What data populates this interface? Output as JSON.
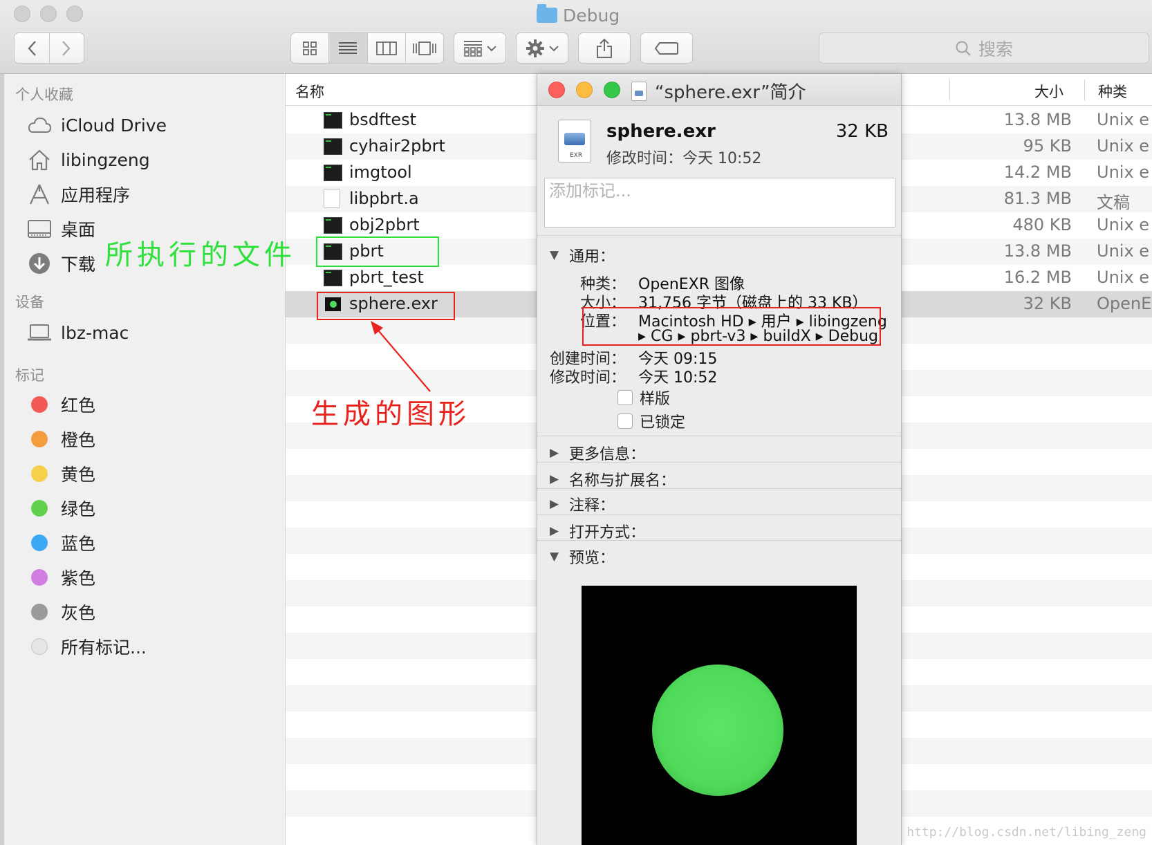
{
  "window": {
    "title": "Debug",
    "traffic_lights": [
      "close",
      "minimize",
      "zoom"
    ]
  },
  "toolbar": {
    "search_placeholder": "搜索",
    "icons": [
      "chevron-left-icon",
      "chevron-right-icon",
      "icon-view-icon",
      "list-view-icon",
      "column-view-icon",
      "cover-flow-icon",
      "arrange-icon",
      "gear-icon",
      "share-icon",
      "tag-icon",
      "search-icon"
    ],
    "active_view": "list"
  },
  "sidebar": {
    "favorites_header": "个人收藏",
    "favorites": [
      {
        "label": "iCloud Drive",
        "icon": "cloud-icon"
      },
      {
        "label": "libingzeng",
        "icon": "home-icon"
      },
      {
        "label": "应用程序",
        "icon": "applications-icon"
      },
      {
        "label": "桌面",
        "icon": "desktop-icon"
      },
      {
        "label": "下载",
        "icon": "downloads-icon"
      }
    ],
    "devices_header": "设备",
    "devices": [
      {
        "label": "lbz-mac",
        "icon": "laptop-icon"
      }
    ],
    "tags_header": "标记",
    "tags": [
      {
        "label": "红色",
        "color": "#f25a55"
      },
      {
        "label": "橙色",
        "color": "#f49d3f"
      },
      {
        "label": "黄色",
        "color": "#f6d04b"
      },
      {
        "label": "绿色",
        "color": "#62cf4d"
      },
      {
        "label": "蓝色",
        "color": "#3da8f3"
      },
      {
        "label": "紫色",
        "color": "#d07fe0"
      },
      {
        "label": "灰色",
        "color": "#9a9a9a"
      },
      {
        "label": "所有标记...",
        "color": "#dcdcdc"
      }
    ]
  },
  "list": {
    "columns": {
      "name": "名称",
      "size": "大小",
      "kind": "种类"
    },
    "rows": [
      {
        "name": "bsdftest",
        "size": "13.8 MB",
        "kind": "Unix e",
        "icon": "exec"
      },
      {
        "name": "cyhair2pbrt",
        "size": "95 KB",
        "kind": "Unix e",
        "icon": "exec"
      },
      {
        "name": "imgtool",
        "size": "14.2 MB",
        "kind": "Unix e",
        "icon": "exec"
      },
      {
        "name": "libpbrt.a",
        "size": "81.3 MB",
        "kind": "文稿",
        "icon": "doc"
      },
      {
        "name": "obj2pbrt",
        "size": "480 KB",
        "kind": "Unix e",
        "icon": "exec"
      },
      {
        "name": "pbrt",
        "size": "13.8 MB",
        "kind": "Unix e",
        "icon": "exec"
      },
      {
        "name": "pbrt_test",
        "size": "16.2 MB",
        "kind": "Unix e",
        "icon": "exec"
      },
      {
        "name": "sphere.exr",
        "size": "32 KB",
        "kind": "OpenE",
        "icon": "exr",
        "selected": true
      }
    ]
  },
  "info": {
    "title": "“sphere.exr”简介",
    "icon_label": "EXR",
    "name": "sphere.exr",
    "size": "32 KB",
    "modified_line": "修改时间：今天 10:52",
    "tags_placeholder": "添加标记...",
    "general_header": "通用：",
    "kind_label": "种类：",
    "kind_value": "OpenEXR 图像",
    "size_label": "大小：",
    "size_value": "31,756 字节（磁盘上的 33 KB）",
    "where_label": "位置：",
    "where_line1": "Macintosh HD ▸ 用户 ▸ libingzeng",
    "where_line2": "▸ CG ▸ pbrt-v3 ▸ buildX ▸ Debug",
    "created_label": "创建时间：",
    "created_value": "今天 09:15",
    "modified_label": "修改时间：",
    "modified_value": "今天 10:52",
    "stationery_label": "样版",
    "locked_label": "已锁定",
    "more_info": "更多信息：",
    "name_ext": "名称与扩展名：",
    "comments": "注释：",
    "open_with": "打开方式：",
    "preview": "预览："
  },
  "annotations": {
    "executed_file": "所执行的文件",
    "generated_image": "生成的图形",
    "green": "#2ee03a",
    "red": "#e8221c"
  },
  "watermark": "http://blog.csdn.net/libing_zeng"
}
